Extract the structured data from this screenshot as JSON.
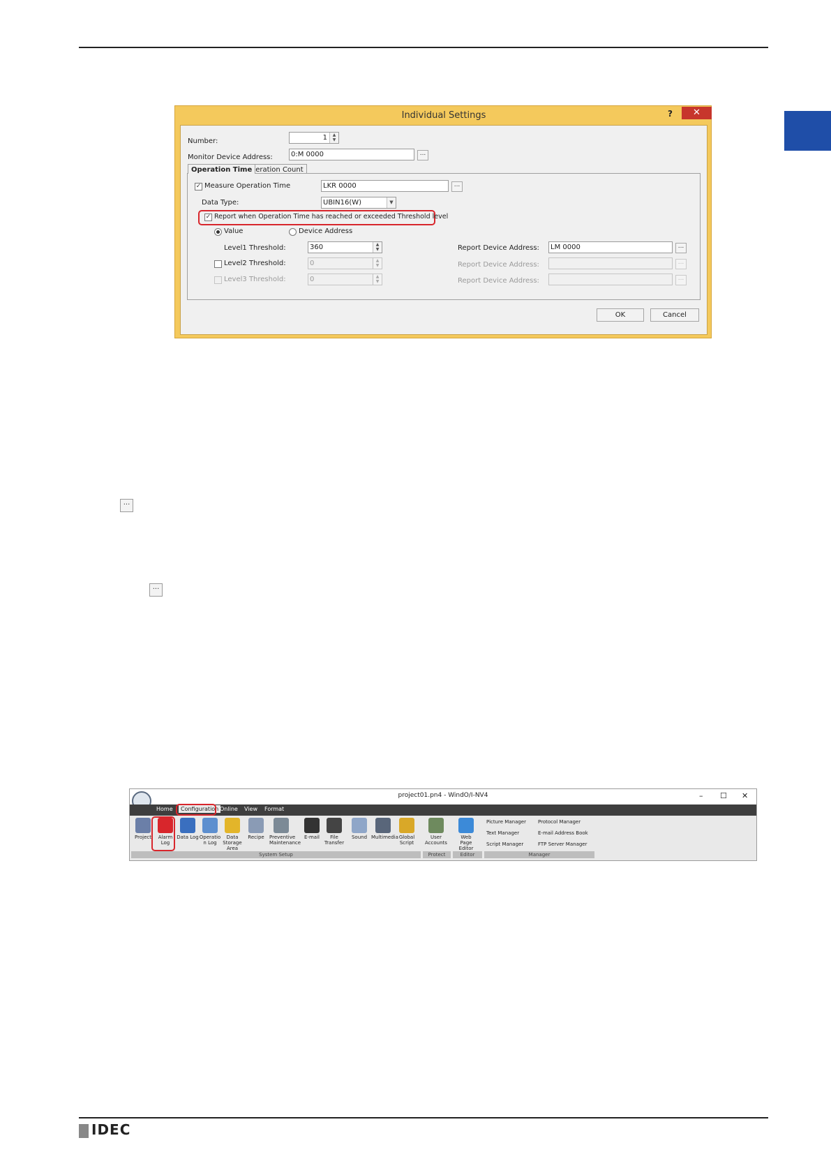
{
  "dialog": {
    "title": "Individual Settings",
    "help": "?",
    "close": "✕",
    "number_label": "Number:",
    "number_value": "1",
    "monitor_label": "Monitor Device Address:",
    "monitor_value": "0:M 0000",
    "dots": "...",
    "tabs": [
      "Operation Time",
      "Operation Count"
    ],
    "measure_label": "Measure Operation Time",
    "measure_value": "LKR 0000",
    "datatype_label": "Data Type:",
    "datatype_value": "UBIN16(W)",
    "report_label": "Report when Operation Time has reached or exceeded Threshold level",
    "radio_value": "Value",
    "radio_device": "Device Address",
    "level1_label": "Level1 Threshold:",
    "level1_value": "360",
    "level2_label": "Level2 Threshold:",
    "level2_value": "0",
    "level3_label": "Level3 Threshold:",
    "level3_value": "0",
    "report_addr_label": "Report Device Address:",
    "report_addr1_value": "LM 0000",
    "ok": "OK",
    "cancel": "Cancel"
  },
  "inline_button": "...",
  "ribbon": {
    "title": "project01.pn4 - WindO/I-NV4",
    "window_controls": [
      "–",
      "☐",
      "✕"
    ],
    "tabs": [
      "Home",
      "Configuration",
      "Online",
      "View",
      "Format"
    ],
    "items": [
      {
        "label": "Project",
        "color": "#6b7fa8"
      },
      {
        "label": "Alarm Log",
        "color": "#d8262c"
      },
      {
        "label": "Data Log",
        "color": "#3a6fbf"
      },
      {
        "label": "Operatio n Log",
        "color": "#5d8fcf"
      },
      {
        "label": "Data Storage Area",
        "color": "#e3b52a"
      },
      {
        "label": "Recipe",
        "color": "#8a9bb5"
      },
      {
        "label": "Preventive Maintenance",
        "color": "#7c8a96"
      },
      {
        "label": "E-mail",
        "color": "#333333"
      },
      {
        "label": "File Transfer",
        "color": "#444444"
      },
      {
        "label": "Sound",
        "color": "#8fa6c8"
      },
      {
        "label": "Multimedia",
        "color": "#59667a"
      },
      {
        "label": "Global Script",
        "color": "#d9a828"
      },
      {
        "label": "User Accounts",
        "color": "#6e8a5e"
      },
      {
        "label": "Web Page Editor",
        "color": "#3c8ad8"
      }
    ],
    "groups": [
      "System Setup",
      "Protect",
      "Editor",
      "Manager"
    ],
    "managers": [
      "Picture Manager",
      "Protocol Manager",
      "Text Manager",
      "E-mail Address Book",
      "Script Manager",
      "FTP Server Manager"
    ]
  },
  "footer": {
    "logo": "IDEC"
  }
}
